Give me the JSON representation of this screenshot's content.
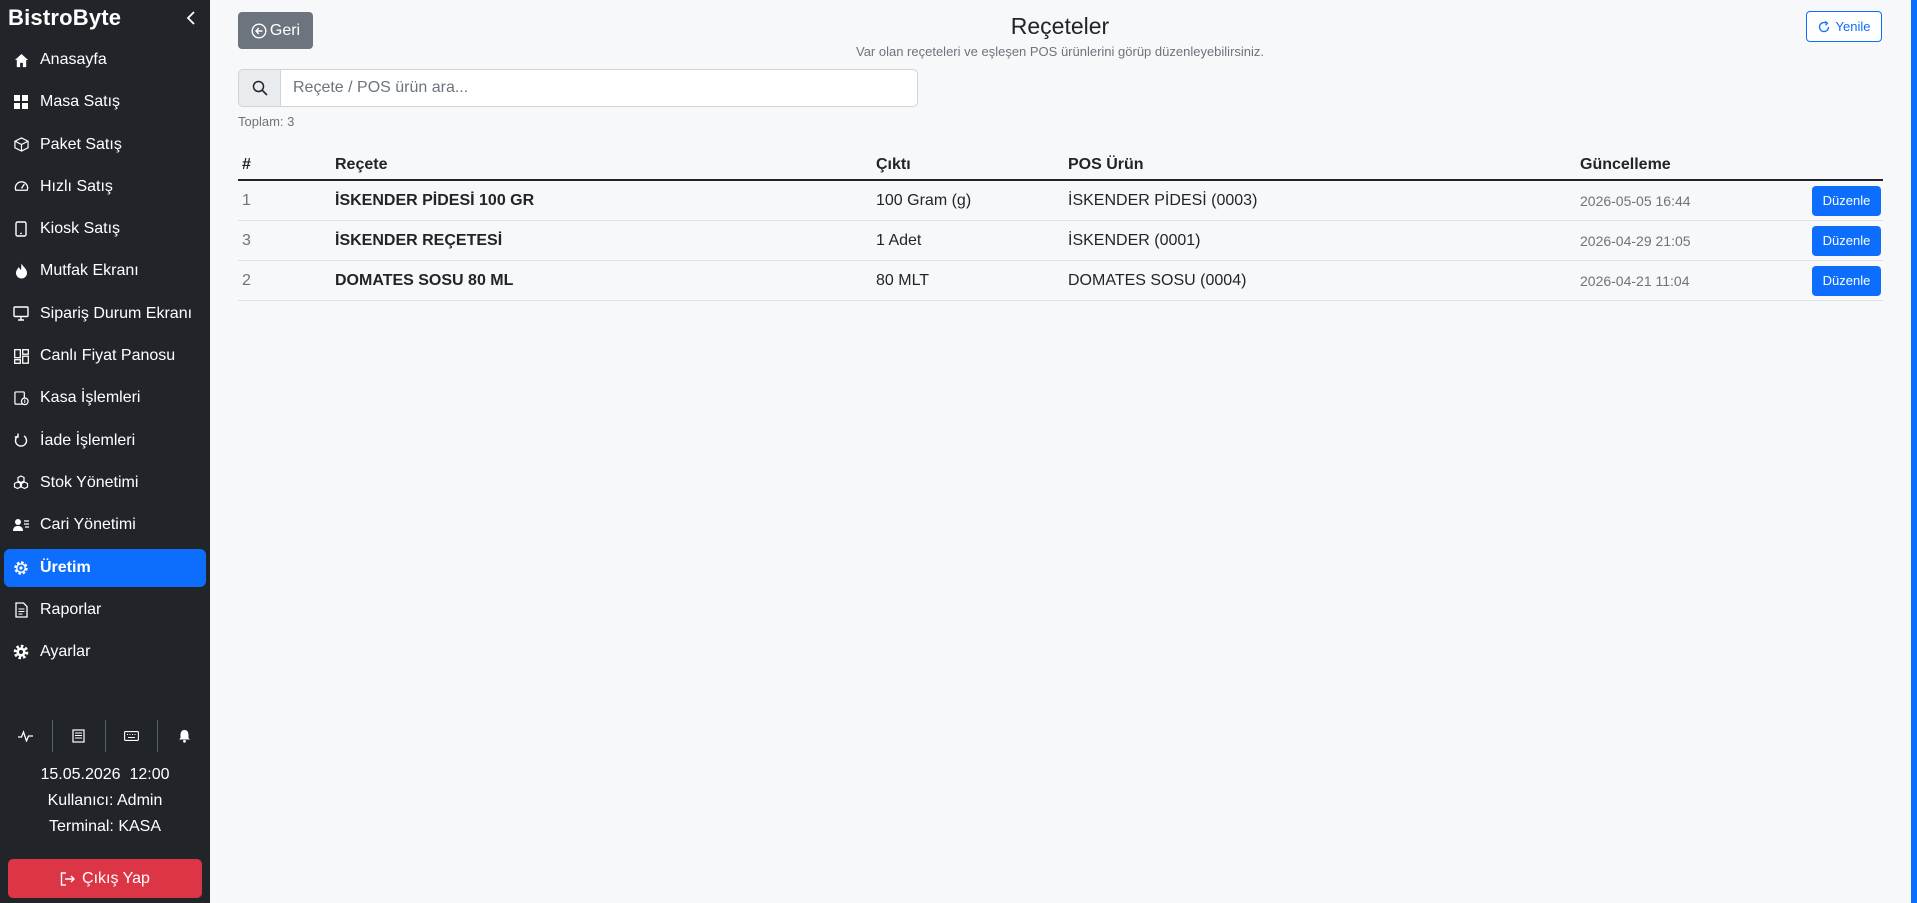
{
  "app": {
    "brand": "BistroByte"
  },
  "sidebar": {
    "items": [
      {
        "label": "Anasayfa",
        "icon": "home-icon"
      },
      {
        "label": "Masa Satış",
        "icon": "grid-icon"
      },
      {
        "label": "Paket Satış",
        "icon": "box-icon"
      },
      {
        "label": "Hızlı Satış",
        "icon": "speedometer-icon"
      },
      {
        "label": "Kiosk Satış",
        "icon": "tablet-icon"
      },
      {
        "label": "Mutfak Ekranı",
        "icon": "fire-icon"
      },
      {
        "label": "Sipariş Durum Ekranı",
        "icon": "monitor-icon"
      },
      {
        "label": "Canlı Fiyat Panosu",
        "icon": "dashboard-icon"
      },
      {
        "label": "Kasa İşlemleri",
        "icon": "cash-register-icon"
      },
      {
        "label": "İade İşlemleri",
        "icon": "undo-icon"
      },
      {
        "label": "Stok Yönetimi",
        "icon": "boxes-icon"
      },
      {
        "label": "Cari Yönetimi",
        "icon": "person-lines-icon"
      },
      {
        "label": "Üretim",
        "icon": "gear-icon",
        "active": true
      },
      {
        "label": "Raporlar",
        "icon": "document-icon"
      },
      {
        "label": "Ayarlar",
        "icon": "settings-icon"
      }
    ],
    "quick_icons": [
      "activity-icon",
      "receipt-icon",
      "keyboard-icon",
      "bell-icon"
    ],
    "info": {
      "datetime": "15.05.2026  12:00",
      "user": "Kullanıcı: Admin",
      "terminal": "Terminal: KASA"
    },
    "logout_label": "Çıkış Yap"
  },
  "header": {
    "back_label": "Geri",
    "title": "Reçeteler",
    "subtitle": "Var olan reçeteleri ve eşleşen POS ürünlerini görüp düzenleyebilirsiniz.",
    "refresh_label": "Yenile"
  },
  "search": {
    "placeholder": "Reçete / POS ürün ara...",
    "value": ""
  },
  "total_text": "Toplam: 3",
  "table": {
    "columns": [
      "#",
      "Reçete",
      "Çıktı",
      "POS Ürün",
      "Güncelleme"
    ],
    "rows": [
      {
        "id": "1",
        "recipe": "İSKENDER PİDESİ 100 GR",
        "output": "100 Gram (g)",
        "pos_product": "İSKENDER PİDESİ (0003)",
        "updated": "2026-05-05 16:44",
        "action": "Düzenle"
      },
      {
        "id": "3",
        "recipe": "İSKENDER REÇETESİ",
        "output": "1 Adet",
        "pos_product": "İSKENDER (0001)",
        "updated": "2026-04-29 21:05",
        "action": "Düzenle"
      },
      {
        "id": "2",
        "recipe": "DOMATES SOSU 80 ML",
        "output": "80 MLT",
        "pos_product": "DOMATES SOSU (0004)",
        "updated": "2026-04-21 11:04",
        "action": "Düzenle"
      }
    ]
  },
  "colors": {
    "sidebar_bg": "#212529",
    "primary": "#0d6efd",
    "danger": "#dc3545",
    "secondary": "#6c757d"
  }
}
